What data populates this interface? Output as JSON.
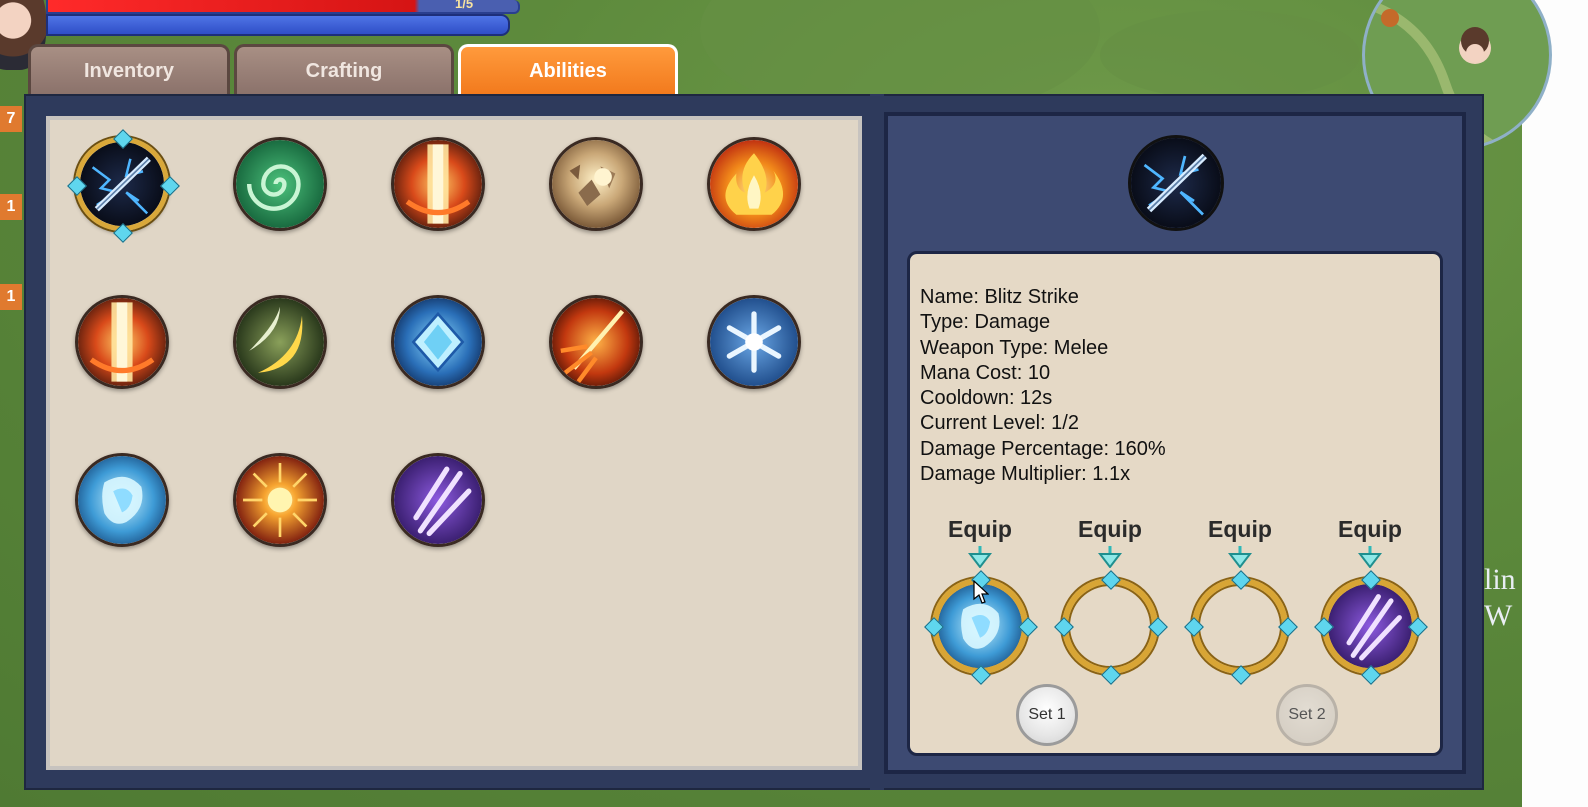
{
  "hud": {
    "hp_text": "1/5",
    "left_numbers": [
      "7",
      "1",
      "1"
    ]
  },
  "tabs": [
    {
      "label": "Inventory",
      "active": false
    },
    {
      "label": "Crafting",
      "active": false
    },
    {
      "label": "Abilities",
      "active": true
    }
  ],
  "abilities": [
    {
      "icon": "blitz-strike-icon",
      "selected": true
    },
    {
      "icon": "green-swirl-icon"
    },
    {
      "icon": "fire-pillar-icon"
    },
    {
      "icon": "rock-blast-icon"
    },
    {
      "icon": "flame-icon"
    },
    {
      "icon": "fire-pillar-icon"
    },
    {
      "icon": "crescent-slash-icon"
    },
    {
      "icon": "ice-crystal-icon"
    },
    {
      "icon": "fire-arrow-icon"
    },
    {
      "icon": "snowflake-icon"
    },
    {
      "icon": "ice-shard-icon"
    },
    {
      "icon": "sun-burst-icon"
    },
    {
      "icon": "purple-claw-icon"
    }
  ],
  "details": {
    "name": "Name: Blitz Strike",
    "type": "Type: Damage",
    "weapon_type": "Weapon Type: Melee",
    "mana_cost": "Mana Cost: 10",
    "cooldown": "Cooldown: 12s",
    "current_level": "Current Level: 1/2",
    "damage_percentage": "Damage Percentage: 160%",
    "damage_multiplier": "Damage Multiplier: 1.1x"
  },
  "equip": {
    "label": "Equip",
    "slots": [
      {
        "icon": "ice-shard-icon"
      },
      {
        "icon": ""
      },
      {
        "icon": ""
      },
      {
        "icon": "purple-claw-icon"
      }
    ]
  },
  "sets": {
    "set1": "Set 1",
    "set2": "Set 2"
  },
  "side_text": {
    "line1": "lin",
    "line2": "W"
  }
}
